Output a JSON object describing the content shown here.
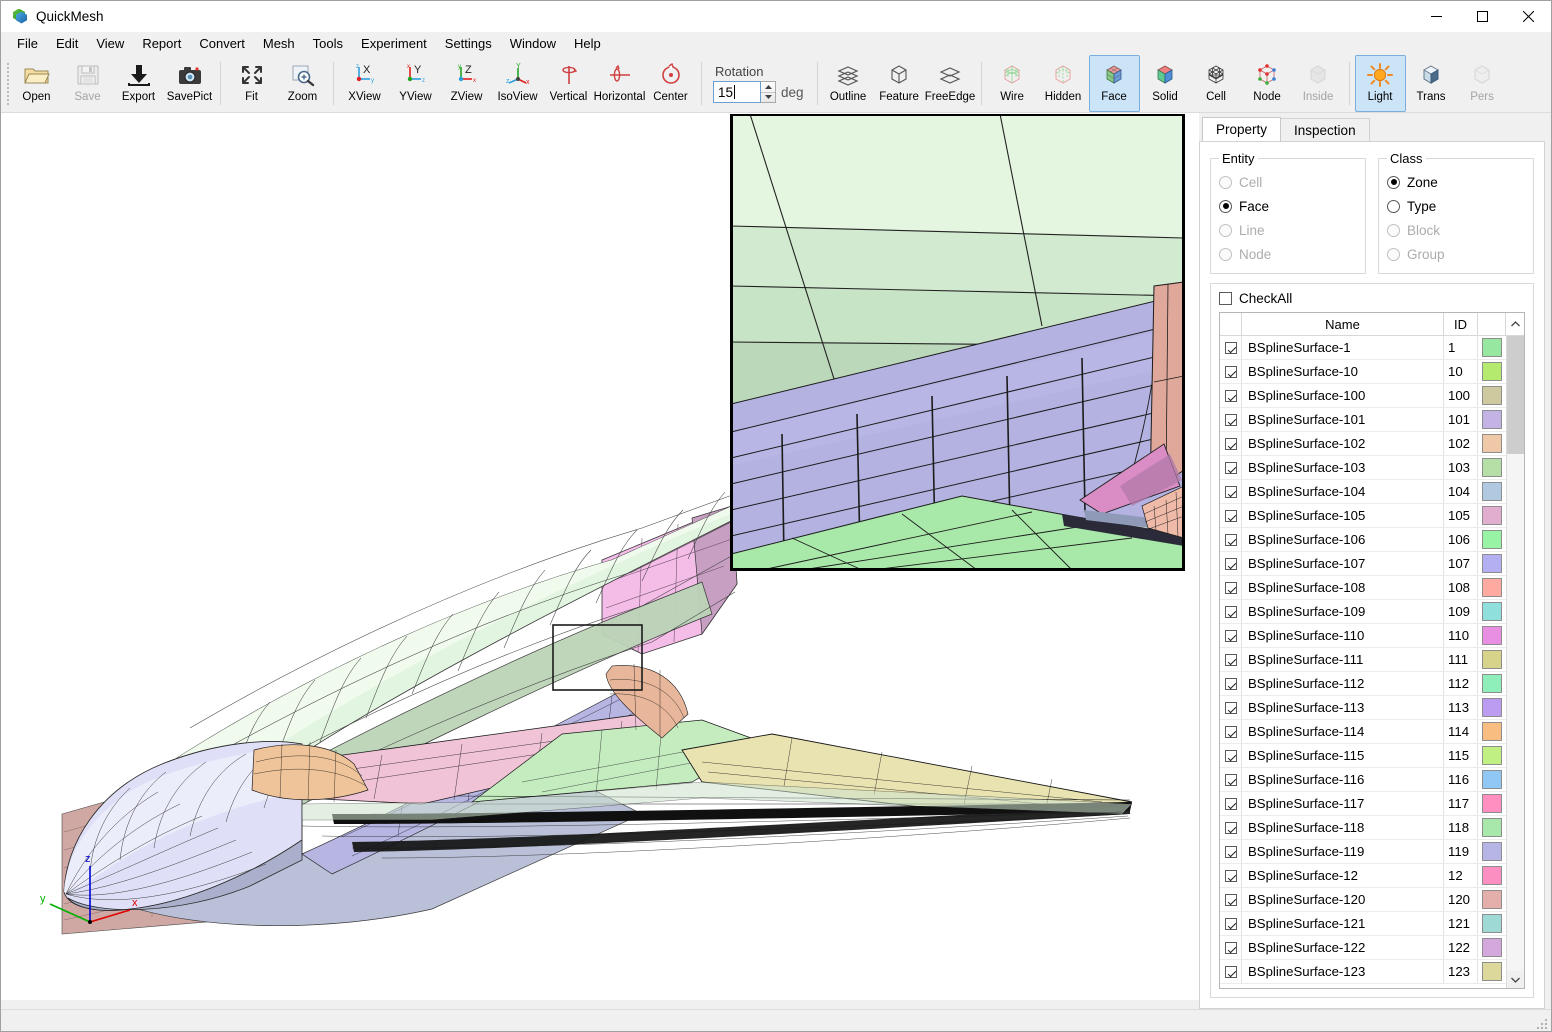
{
  "window": {
    "title": "QuickMesh",
    "icon": "cube-logo-icon",
    "minimize_label": "Minimize",
    "maximize_label": "Maximize",
    "close_label": "Close"
  },
  "menubar": [
    {
      "label": "File"
    },
    {
      "label": "Edit"
    },
    {
      "label": "View"
    },
    {
      "label": "Report"
    },
    {
      "label": "Convert"
    },
    {
      "label": "Mesh"
    },
    {
      "label": "Tools"
    },
    {
      "label": "Experiment"
    },
    {
      "label": "Settings"
    },
    {
      "label": "Window"
    },
    {
      "label": "Help"
    }
  ],
  "toolbar": {
    "file_group": [
      {
        "label": "Open",
        "icon": "folder-open-icon",
        "enabled": true,
        "active": false
      },
      {
        "label": "Save",
        "icon": "floppy-disk-icon",
        "enabled": false,
        "active": false
      },
      {
        "label": "Export",
        "icon": "download-arrow-icon",
        "enabled": true,
        "active": false
      },
      {
        "label": "SavePict",
        "icon": "camera-icon",
        "enabled": true,
        "active": false
      }
    ],
    "view_group": [
      {
        "label": "Fit",
        "icon": "fit-arrows-icon",
        "enabled": true,
        "active": false
      },
      {
        "label": "Zoom",
        "icon": "magnifier-plus-icon",
        "enabled": true,
        "active": false
      }
    ],
    "axis_group": [
      {
        "label": "XView",
        "icon": "x-axis-view-icon",
        "enabled": true,
        "active": false
      },
      {
        "label": "YView",
        "icon": "y-axis-view-icon",
        "enabled": true,
        "active": false
      },
      {
        "label": "ZView",
        "icon": "z-axis-view-icon",
        "enabled": true,
        "active": false
      },
      {
        "label": "IsoView",
        "icon": "iso-axis-view-icon",
        "enabled": true,
        "active": false
      }
    ],
    "rotate_group": [
      {
        "label": "Vertical",
        "icon": "rotate-vertical-icon",
        "enabled": true,
        "active": false
      },
      {
        "label": "Horizontal",
        "icon": "rotate-horizontal-icon",
        "enabled": true,
        "active": false
      },
      {
        "label": "Center",
        "icon": "rotate-center-icon",
        "enabled": true,
        "active": false
      }
    ],
    "rotation": {
      "label": "Rotation",
      "value": "15",
      "unit": "deg",
      "spinner_up": "spinner-up-icon",
      "spinner_down": "spinner-down-icon"
    },
    "edge_group": [
      {
        "label": "Outline",
        "icon": "stacked-layers-icon",
        "enabled": true,
        "active": false
      },
      {
        "label": "Feature",
        "icon": "wire-cube-icon",
        "enabled": true,
        "active": false
      },
      {
        "label": "FreeEdge",
        "icon": "free-edge-icon",
        "enabled": true,
        "active": false
      }
    ],
    "render_group": [
      {
        "label": "Wire",
        "icon": "wire-mesh-cube-icon",
        "enabled": true,
        "active": false
      },
      {
        "label": "Hidden",
        "icon": "hidden-line-cube-icon",
        "enabled": true,
        "active": false
      },
      {
        "label": "Face",
        "icon": "face-cube-icon",
        "enabled": true,
        "active": true
      },
      {
        "label": "Solid",
        "icon": "solid-cube-icon",
        "enabled": true,
        "active": false
      },
      {
        "label": "Cell",
        "icon": "cell-grid-cube-icon",
        "enabled": true,
        "active": false
      },
      {
        "label": "Node",
        "icon": "node-points-cube-icon",
        "enabled": true,
        "active": false
      },
      {
        "label": "Inside",
        "icon": "inside-cube-icon",
        "enabled": false,
        "active": false
      }
    ],
    "display_group": [
      {
        "label": "Light",
        "icon": "sun-light-icon",
        "enabled": true,
        "active": true
      },
      {
        "label": "Trans",
        "icon": "transparent-cube-icon",
        "enabled": true,
        "active": false
      },
      {
        "label": "Pers",
        "icon": "perspective-cube-icon",
        "enabled": false,
        "active": false
      }
    ]
  },
  "viewport": {
    "axis_triad": {
      "x_label": "x",
      "y_label": "y",
      "z_label": "z",
      "x_color": "#e00000",
      "y_color": "#00b000",
      "z_color": "#0000d8"
    },
    "model": "aircraft-wing-body-mesh",
    "background": "#ffffff",
    "zoom_inset_label": "magnified-detail-inset",
    "selection_box_label": "zoom-selection-rectangle"
  },
  "panel": {
    "tabs": [
      {
        "label": "Property",
        "selected": true
      },
      {
        "label": "Inspection",
        "selected": false
      }
    ],
    "entity": {
      "legend": "Entity",
      "options": [
        {
          "label": "Cell",
          "selected": false,
          "enabled": false
        },
        {
          "label": "Face",
          "selected": true,
          "enabled": true
        },
        {
          "label": "Line",
          "selected": false,
          "enabled": false
        },
        {
          "label": "Node",
          "selected": false,
          "enabled": false
        }
      ]
    },
    "klass": {
      "legend": "Class",
      "options": [
        {
          "label": "Zone",
          "selected": true,
          "enabled": true
        },
        {
          "label": "Type",
          "selected": false,
          "enabled": true
        },
        {
          "label": "Block",
          "selected": false,
          "enabled": false
        },
        {
          "label": "Group",
          "selected": false,
          "enabled": false
        }
      ]
    },
    "check_all": {
      "label": "CheckAll",
      "checked": false
    },
    "grid": {
      "columns": [
        "",
        "Name",
        "ID",
        ""
      ],
      "scroll_up_icon": "chevron-up-icon",
      "scroll_down_icon": "chevron-down-icon",
      "rows": [
        {
          "checked": true,
          "name": "BSplineSurface-1",
          "id": "1",
          "color": "#97e7a0"
        },
        {
          "checked": true,
          "name": "BSplineSurface-10",
          "id": "10",
          "color": "#b4ea6e"
        },
        {
          "checked": true,
          "name": "BSplineSurface-100",
          "id": "100",
          "color": "#cfc9a0"
        },
        {
          "checked": true,
          "name": "BSplineSurface-101",
          "id": "101",
          "color": "#c3b3e4"
        },
        {
          "checked": true,
          "name": "BSplineSurface-102",
          "id": "102",
          "color": "#efc8a7"
        },
        {
          "checked": true,
          "name": "BSplineSurface-103",
          "id": "103",
          "color": "#b6dfa8"
        },
        {
          "checked": true,
          "name": "BSplineSurface-104",
          "id": "104",
          "color": "#b0c9e0"
        },
        {
          "checked": true,
          "name": "BSplineSurface-105",
          "id": "105",
          "color": "#e2aed0"
        },
        {
          "checked": true,
          "name": "BSplineSurface-106",
          "id": "106",
          "color": "#99f3a4"
        },
        {
          "checked": true,
          "name": "BSplineSurface-107",
          "id": "107",
          "color": "#b4aef3"
        },
        {
          "checked": true,
          "name": "BSplineSurface-108",
          "id": "108",
          "color": "#ffa9a0"
        },
        {
          "checked": true,
          "name": "BSplineSurface-109",
          "id": "109",
          "color": "#8fe0dc"
        },
        {
          "checked": true,
          "name": "BSplineSurface-110",
          "id": "110",
          "color": "#e88fe3"
        },
        {
          "checked": true,
          "name": "BSplineSurface-111",
          "id": "111",
          "color": "#d8d38a"
        },
        {
          "checked": true,
          "name": "BSplineSurface-112",
          "id": "112",
          "color": "#8fefbb"
        },
        {
          "checked": true,
          "name": "BSplineSurface-113",
          "id": "113",
          "color": "#bb9cf0"
        },
        {
          "checked": true,
          "name": "BSplineSurface-114",
          "id": "114",
          "color": "#f8bd81"
        },
        {
          "checked": true,
          "name": "BSplineSurface-115",
          "id": "115",
          "color": "#c0f083"
        },
        {
          "checked": true,
          "name": "BSplineSurface-116",
          "id": "116",
          "color": "#8fc8f5"
        },
        {
          "checked": true,
          "name": "BSplineSurface-117",
          "id": "117",
          "color": "#ff8fc0"
        },
        {
          "checked": true,
          "name": "BSplineSurface-118",
          "id": "118",
          "color": "#a9e8ab"
        },
        {
          "checked": true,
          "name": "BSplineSurface-119",
          "id": "119",
          "color": "#b7b4e6"
        },
        {
          "checked": true,
          "name": "BSplineSurface-12",
          "id": "12",
          "color": "#fb8fc2"
        },
        {
          "checked": true,
          "name": "BSplineSurface-120",
          "id": "120",
          "color": "#e4afaa"
        },
        {
          "checked": true,
          "name": "BSplineSurface-121",
          "id": "121",
          "color": "#9fd9d6"
        },
        {
          "checked": true,
          "name": "BSplineSurface-122",
          "id": "122",
          "color": "#d4a8dd"
        },
        {
          "checked": true,
          "name": "BSplineSurface-123",
          "id": "123",
          "color": "#dcd79b"
        }
      ]
    }
  },
  "statusbar": {
    "text": "",
    "grip_icon": "resize-grip-icon"
  }
}
